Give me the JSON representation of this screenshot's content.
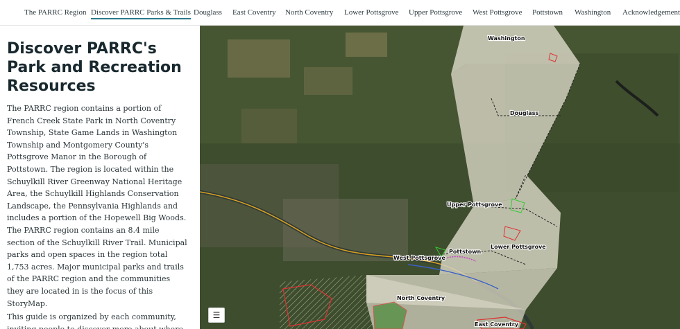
{
  "nav": {
    "items": [
      {
        "label": "The PARRC Region"
      },
      {
        "label": "Discover PARRC Parks & Trails"
      },
      {
        "label": "Douglass"
      },
      {
        "label": "East Coventry"
      },
      {
        "label": "North Coventry"
      },
      {
        "label": "Lower Pottsgrove"
      },
      {
        "label": "Upper Pottsgrove"
      },
      {
        "label": "West Pottsgrove"
      },
      {
        "label": "Pottstown"
      },
      {
        "label": "Washington"
      },
      {
        "label": "Acknowledgement"
      }
    ],
    "active_index": 1,
    "accent_color": "#2b7a8c"
  },
  "sidebar": {
    "title": "Discover PARRC's Park and Recreation Resources",
    "paragraph1": "The PARRC region contains a portion of French Creek State Park in North Coventry Township, State Game Lands in Washington Township and Montgomery County's Pottsgrove Manor in the Borough of Pottstown. The region is located within the Schuylkill River Greenway National Heritage Area, the Schuylkill Highlands Conservation Landscape, the Pennsylvania Highlands and includes a portion of the Hopewell Big Woods. The PARRC region contains an 8.4 mile section of the Schuylkill River Trail. Municipal parks and open spaces in the region total 1,753 acres. Major municipal parks and trails of the PARRC region and the communities they are located in is the focus of this StoryMap.",
    "paragraph2": "This guide is organized by each community, inviting people to discover more about where"
  },
  "map": {
    "labels": {
      "washington": "Washington",
      "douglass": "Douglass",
      "upper_pottsgrove": "Upper Pottsgrove",
      "lower_pottsgrove": "Lower Pottsgrove",
      "pottstown": "Pottstown",
      "west_pottsgrove": "West Pottsgrove",
      "north_coventry": "North Coventry",
      "east_coventry": "East Coventry"
    },
    "legend_icon": "list-icon"
  }
}
